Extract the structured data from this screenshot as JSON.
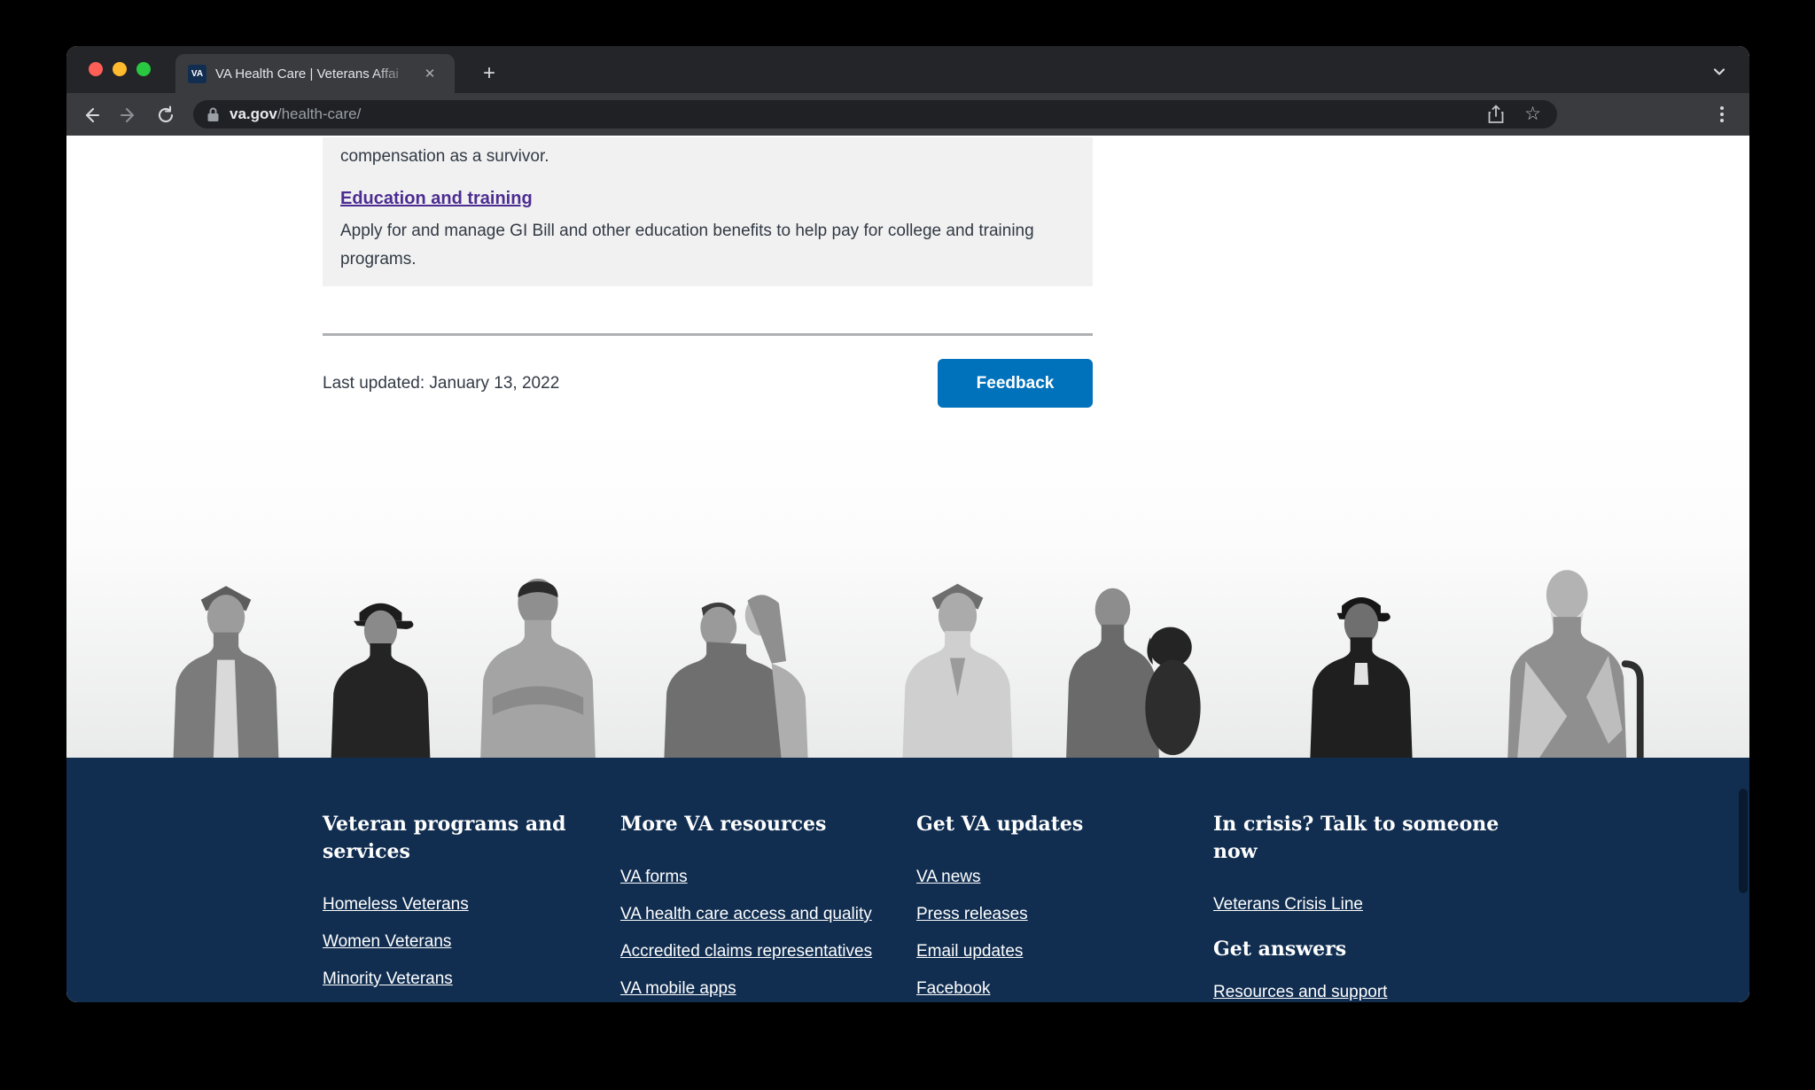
{
  "browser": {
    "window_controls": {
      "close": "close",
      "minimize": "minimize",
      "maximize": "maximize"
    },
    "tab": {
      "favicon_text": "VA",
      "title": "VA Health Care | Veterans Affai"
    },
    "icons": {
      "tab_close": "✕",
      "new_tab": "+",
      "star": "☆",
      "more_menu_dots": "⋮"
    },
    "url": {
      "domain": "va.gov",
      "path": "/health-care/"
    }
  },
  "page": {
    "card": {
      "clipped_line": "compensation as a survivor.",
      "link_label": "Education and training",
      "description": "Apply for and manage GI Bill and other education benefits to help pay for college and training programs."
    },
    "last_updated": "Last updated: January 13, 2022",
    "feedback_label": "Feedback",
    "photo_strip_alt": "Black-and-white portraits of eight veterans and family members"
  },
  "footer": {
    "columns": [
      {
        "heading": "Veteran programs and services",
        "links": [
          "Homeless Veterans",
          "Women Veterans",
          "Minority Veterans"
        ]
      },
      {
        "heading": "More VA resources",
        "links": [
          "VA forms",
          "VA health care access and quality",
          "Accredited claims representatives",
          "VA mobile apps"
        ]
      },
      {
        "heading": "Get VA updates",
        "links": [
          "VA news",
          "Press releases",
          "Email updates",
          "Facebook"
        ]
      },
      {
        "heading": "In crisis? Talk to someone now",
        "links": [
          "Veterans Crisis Line"
        ],
        "heading2": "Get answers",
        "links2": [
          "Resources and support"
        ]
      }
    ]
  },
  "colors": {
    "accent_blue": "#0071bb",
    "footer_navy": "#112e51",
    "visited_link_purple": "#4c2c92",
    "card_gray": "#f1f1f1"
  }
}
